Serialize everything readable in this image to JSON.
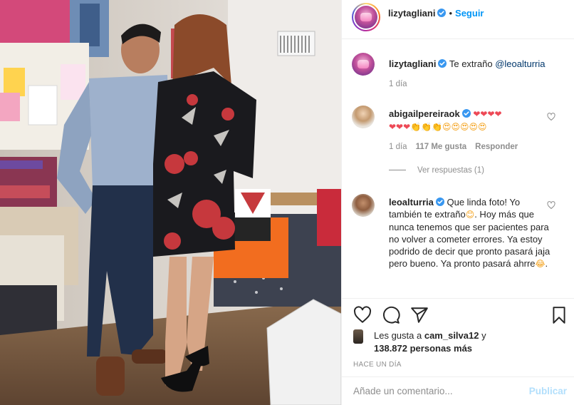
{
  "post": {
    "author": "lizytagliani",
    "follow_label": "Seguir",
    "separator": "•"
  },
  "caption": {
    "username": "lizytagliani",
    "text": "Te extraño",
    "mention": "@leoalturria",
    "time": "1 día"
  },
  "comments": [
    {
      "username": "abigailpereiraok",
      "line1_hearts": "❤❤❤❤",
      "line2_hearts": "❤❤❤",
      "line2_claps": "👏👏👏",
      "line2_faces": "😍😍😍😍😍",
      "time": "1 día",
      "likes": "117 Me gusta",
      "reply_label": "Responder",
      "view_replies": "Ver respuestas (1)"
    },
    {
      "username": "leoalturria",
      "text_a": "Que linda foto! Yo también te extraño",
      "emoji_a": "😊",
      "text_b": ". Hoy más que nunca tenemos que ser pacientes para no volver a cometer errores. Ya estoy podrido de decir que pronto pasará jaja pero bueno. Ya pronto pasará ahrre",
      "emoji_b": "😂",
      "text_c": "."
    }
  ],
  "likes": {
    "prefix": "Les gusta a",
    "user": "cam_silva12",
    "suffix": "y",
    "others": "138.872 personas más"
  },
  "posted_ago": "HACE UN DÍA",
  "comment_box": {
    "placeholder": "Añade un comentario...",
    "publish_label": "Publicar"
  },
  "colors": {
    "accent": "#0095f6",
    "heart": "#ed4956",
    "verified": "#3897f0",
    "muted": "#8e8e8e",
    "publish_disabled": "#b2dffc"
  },
  "icons": [
    "verified-badge-icon",
    "heart-icon",
    "comment-icon",
    "share-icon",
    "bookmark-icon",
    "small-heart-icon"
  ]
}
